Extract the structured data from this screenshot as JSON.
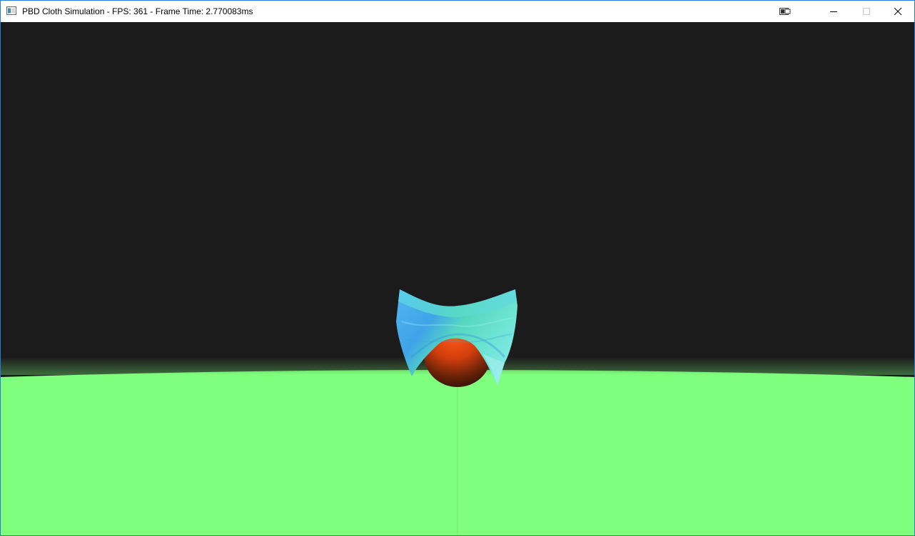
{
  "window": {
    "title": "PBD Cloth Simulation - FPS: 361 - Frame Time: 2.770083ms"
  },
  "titlebar_icons": {
    "app": "app-window-icon",
    "snap": "snap-layout-icon",
    "minimize": "minimize-icon",
    "maximize": "maximize-icon",
    "close": "close-icon"
  },
  "colors": {
    "background": "#1b1b1b",
    "ground": "#80ff7e",
    "sphere": "#d8400e",
    "cloth": "#4fc7e0",
    "window_border": "#2b79d8"
  }
}
